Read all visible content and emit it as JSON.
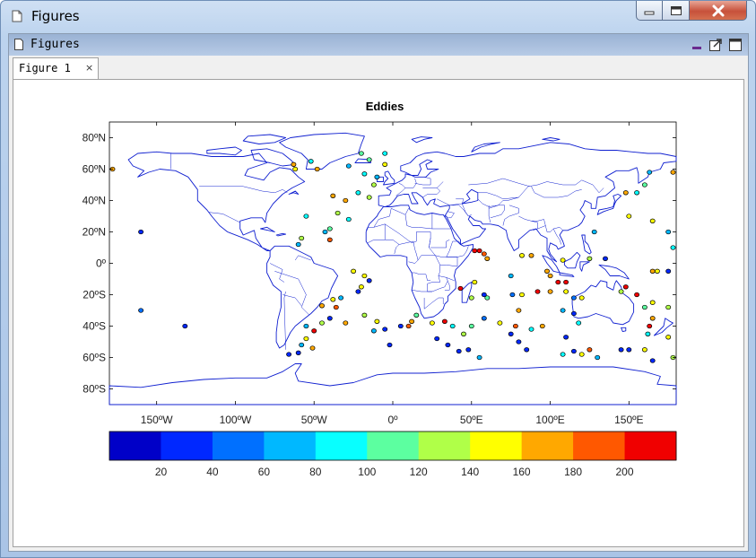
{
  "window": {
    "title": "Figures"
  },
  "panel": {
    "title": "Figures"
  },
  "tabs": [
    {
      "label": "Figure 1",
      "close": "×"
    }
  ],
  "chart_data": {
    "type": "scatter",
    "title": "Eddies",
    "projection": "equirectangular world map with coastlines and country borders",
    "xlabel": "",
    "ylabel": "",
    "xlim": [
      -180,
      180
    ],
    "ylim": [
      -90,
      90
    ],
    "xticks": [
      {
        "value": -150,
        "label": "150ºW"
      },
      {
        "value": -100,
        "label": "100ºW"
      },
      {
        "value": -50,
        "label": "50ºW"
      },
      {
        "value": 0,
        "label": "0º"
      },
      {
        "value": 50,
        "label": "50ºE"
      },
      {
        "value": 100,
        "label": "100ºE"
      },
      {
        "value": 150,
        "label": "150ºE"
      }
    ],
    "yticks": [
      {
        "value": 80,
        "label": "80ºN"
      },
      {
        "value": 60,
        "label": "60ºN"
      },
      {
        "value": 40,
        "label": "40ºN"
      },
      {
        "value": 20,
        "label": "20ºN"
      },
      {
        "value": 0,
        "label": "0º"
      },
      {
        "value": -20,
        "label": "20ºS"
      },
      {
        "value": -40,
        "label": "40ºS"
      },
      {
        "value": -60,
        "label": "60ºS"
      },
      {
        "value": -80,
        "label": "80ºS"
      }
    ],
    "grid": false,
    "colorbar": {
      "orientation": "horizontal",
      "placement": "bottom",
      "min": 0,
      "max": 220,
      "ticks": [
        20,
        40,
        60,
        80,
        100,
        120,
        140,
        160,
        180,
        200
      ],
      "colors": [
        "#0000c8",
        "#0028ff",
        "#0070ff",
        "#00b8ff",
        "#08ffff",
        "#5cffa0",
        "#b0ff48",
        "#ffff00",
        "#ffa800",
        "#ff5800",
        "#f00000"
      ]
    },
    "points": [
      {
        "lon": -63,
        "lat": 63,
        "v": 175
      },
      {
        "lon": -62,
        "lat": 60,
        "v": 150
      },
      {
        "lon": -48,
        "lat": 60,
        "v": 160
      },
      {
        "lon": -52,
        "lat": 65,
        "v": 90
      },
      {
        "lon": -38,
        "lat": 43,
        "v": 170
      },
      {
        "lon": -30,
        "lat": 40,
        "v": 160
      },
      {
        "lon": -22,
        "lat": 45,
        "v": 90
      },
      {
        "lon": -15,
        "lat": 42,
        "v": 130
      },
      {
        "lon": -12,
        "lat": 50,
        "v": 120
      },
      {
        "lon": -10,
        "lat": 55,
        "v": 70
      },
      {
        "lon": -18,
        "lat": 57,
        "v": 80
      },
      {
        "lon": -28,
        "lat": 62,
        "v": 60
      },
      {
        "lon": -5,
        "lat": 63,
        "v": 140
      },
      {
        "lon": -15,
        "lat": 66,
        "v": 100
      },
      {
        "lon": -5,
        "lat": 70,
        "v": 90
      },
      {
        "lon": -20,
        "lat": 70,
        "v": 110
      },
      {
        "lon": -35,
        "lat": 32,
        "v": 130
      },
      {
        "lon": -28,
        "lat": 28,
        "v": 80
      },
      {
        "lon": -40,
        "lat": 22,
        "v": 110
      },
      {
        "lon": -43,
        "lat": 20,
        "v": 60
      },
      {
        "lon": -55,
        "lat": 30,
        "v": 90
      },
      {
        "lon": -58,
        "lat": 16,
        "v": 130
      },
      {
        "lon": -60,
        "lat": 12,
        "v": 60
      },
      {
        "lon": -40,
        "lat": 15,
        "v": 190
      },
      {
        "lon": -18,
        "lat": -8,
        "v": 140
      },
      {
        "lon": -15,
        "lat": -11,
        "v": 30
      },
      {
        "lon": -20,
        "lat": -15,
        "v": 150
      },
      {
        "lon": -22,
        "lat": -18,
        "v": 30
      },
      {
        "lon": -33,
        "lat": -22,
        "v": 60
      },
      {
        "lon": -38,
        "lat": -23,
        "v": 150
      },
      {
        "lon": -45,
        "lat": -27,
        "v": 170
      },
      {
        "lon": -36,
        "lat": -28,
        "v": 190
      },
      {
        "lon": -40,
        "lat": -35,
        "v": 20
      },
      {
        "lon": -45,
        "lat": -38,
        "v": 120
      },
      {
        "lon": -55,
        "lat": -40,
        "v": 70
      },
      {
        "lon": -50,
        "lat": -43,
        "v": 200
      },
      {
        "lon": -55,
        "lat": -48,
        "v": 140
      },
      {
        "lon": -58,
        "lat": -52,
        "v": 60
      },
      {
        "lon": -51,
        "lat": -54,
        "v": 160
      },
      {
        "lon": -60,
        "lat": -57,
        "v": 30
      },
      {
        "lon": -66,
        "lat": -58,
        "v": 20
      },
      {
        "lon": -30,
        "lat": -38,
        "v": 170
      },
      {
        "lon": -18,
        "lat": -33,
        "v": 130
      },
      {
        "lon": -10,
        "lat": -37,
        "v": 150
      },
      {
        "lon": -12,
        "lat": -43,
        "v": 60
      },
      {
        "lon": -5,
        "lat": -42,
        "v": 20
      },
      {
        "lon": 5,
        "lat": -40,
        "v": 30
      },
      {
        "lon": -2,
        "lat": -52,
        "v": 20
      },
      {
        "lon": 10,
        "lat": -40,
        "v": 190
      },
      {
        "lon": 12,
        "lat": -37,
        "v": 160
      },
      {
        "lon": 15,
        "lat": -33,
        "v": 100
      },
      {
        "lon": 25,
        "lat": -38,
        "v": 140
      },
      {
        "lon": 33,
        "lat": -37,
        "v": 200
      },
      {
        "lon": 38,
        "lat": -40,
        "v": 90
      },
      {
        "lon": 28,
        "lat": -48,
        "v": 20
      },
      {
        "lon": 35,
        "lat": -52,
        "v": 20
      },
      {
        "lon": 42,
        "lat": -56,
        "v": 30
      },
      {
        "lon": 48,
        "lat": -55,
        "v": 20
      },
      {
        "lon": 55,
        "lat": -60,
        "v": 70
      },
      {
        "lon": 45,
        "lat": -45,
        "v": 120
      },
      {
        "lon": 50,
        "lat": -40,
        "v": 110
      },
      {
        "lon": 58,
        "lat": -35,
        "v": 40
      },
      {
        "lon": 68,
        "lat": -38,
        "v": 140
      },
      {
        "lon": 60,
        "lat": -22,
        "v": 100
      },
      {
        "lon": 50,
        "lat": -22,
        "v": 130
      },
      {
        "lon": 43,
        "lat": -16,
        "v": 200
      },
      {
        "lon": 52,
        "lat": -12,
        "v": 140
      },
      {
        "lon": 58,
        "lat": -20,
        "v": 20
      },
      {
        "lon": 52,
        "lat": 8,
        "v": 200
      },
      {
        "lon": 55,
        "lat": 8,
        "v": 210
      },
      {
        "lon": 58,
        "lat": 6,
        "v": 180
      },
      {
        "lon": 60,
        "lat": 3,
        "v": 160
      },
      {
        "lon": 75,
        "lat": -8,
        "v": 70
      },
      {
        "lon": 82,
        "lat": -20,
        "v": 140
      },
      {
        "lon": 76,
        "lat": -20,
        "v": 40
      },
      {
        "lon": 80,
        "lat": -30,
        "v": 160
      },
      {
        "lon": 78,
        "lat": -40,
        "v": 190
      },
      {
        "lon": 75,
        "lat": -45,
        "v": 30
      },
      {
        "lon": 80,
        "lat": -50,
        "v": 30
      },
      {
        "lon": 85,
        "lat": -55,
        "v": 20
      },
      {
        "lon": 88,
        "lat": -42,
        "v": 80
      },
      {
        "lon": 95,
        "lat": -40,
        "v": 170
      },
      {
        "lon": 92,
        "lat": -18,
        "v": 200
      },
      {
        "lon": 100,
        "lat": -18,
        "v": 170
      },
      {
        "lon": 110,
        "lat": -18,
        "v": 150
      },
      {
        "lon": 115,
        "lat": -22,
        "v": 40
      },
      {
        "lon": 120,
        "lat": -22,
        "v": 150
      },
      {
        "lon": 108,
        "lat": -30,
        "v": 60
      },
      {
        "lon": 115,
        "lat": -32,
        "v": 20
      },
      {
        "lon": 118,
        "lat": -38,
        "v": 80
      },
      {
        "lon": 110,
        "lat": -47,
        "v": 30
      },
      {
        "lon": 115,
        "lat": -56,
        "v": 30
      },
      {
        "lon": 108,
        "lat": -58,
        "v": 80
      },
      {
        "lon": 120,
        "lat": -58,
        "v": 140
      },
      {
        "lon": 125,
        "lat": -55,
        "v": 190
      },
      {
        "lon": 130,
        "lat": -60,
        "v": 70
      },
      {
        "lon": 145,
        "lat": -55,
        "v": 30
      },
      {
        "lon": 150,
        "lat": -55,
        "v": 20
      },
      {
        "lon": 160,
        "lat": -55,
        "v": 150
      },
      {
        "lon": 165,
        "lat": -62,
        "v": 20
      },
      {
        "lon": 175,
        "lat": -47,
        "v": 140
      },
      {
        "lon": 178,
        "lat": -60,
        "v": 120
      },
      {
        "lon": 175,
        "lat": -28,
        "v": 130
      },
      {
        "lon": 165,
        "lat": -25,
        "v": 140
      },
      {
        "lon": 160,
        "lat": -28,
        "v": 100
      },
      {
        "lon": 165,
        "lat": -35,
        "v": 160
      },
      {
        "lon": 163,
        "lat": -40,
        "v": 210
      },
      {
        "lon": 162,
        "lat": -45,
        "v": 80
      },
      {
        "lon": 155,
        "lat": -20,
        "v": 210
      },
      {
        "lon": 145,
        "lat": -18,
        "v": 130
      },
      {
        "lon": 148,
        "lat": -15,
        "v": 200
      },
      {
        "lon": 165,
        "lat": -5,
        "v": 160
      },
      {
        "lon": 168,
        "lat": -5,
        "v": 140
      },
      {
        "lon": 175,
        "lat": -5,
        "v": 20
      },
      {
        "lon": 178,
        "lat": 10,
        "v": 90
      },
      {
        "lon": 175,
        "lat": 20,
        "v": 60
      },
      {
        "lon": 165,
        "lat": 27,
        "v": 150
      },
      {
        "lon": 150,
        "lat": 30,
        "v": 150
      },
      {
        "lon": 128,
        "lat": 20,
        "v": 60
      },
      {
        "lon": 125,
        "lat": 3,
        "v": 120
      },
      {
        "lon": 135,
        "lat": 3,
        "v": 30
      },
      {
        "lon": 108,
        "lat": 2,
        "v": 140
      },
      {
        "lon": 100,
        "lat": -8,
        "v": 170
      },
      {
        "lon": 98,
        "lat": -5,
        "v": 160
      },
      {
        "lon": 105,
        "lat": -12,
        "v": 210
      },
      {
        "lon": 110,
        "lat": -12,
        "v": 200
      },
      {
        "lon": 88,
        "lat": 5,
        "v": 160
      },
      {
        "lon": 82,
        "lat": 5,
        "v": 150
      },
      {
        "lon": 148,
        "lat": 45,
        "v": 160
      },
      {
        "lon": 155,
        "lat": 45,
        "v": 80
      },
      {
        "lon": 160,
        "lat": 50,
        "v": 100
      },
      {
        "lon": 163,
        "lat": 58,
        "v": 60
      },
      {
        "lon": 178,
        "lat": 58,
        "v": 170
      },
      {
        "lon": -178,
        "lat": 60,
        "v": 160
      },
      {
        "lon": -160,
        "lat": 20,
        "v": 30
      },
      {
        "lon": -160,
        "lat": -30,
        "v": 40
      },
      {
        "lon": -132,
        "lat": -40,
        "v": 20
      },
      {
        "lon": -25,
        "lat": -5,
        "v": 140
      }
    ]
  }
}
